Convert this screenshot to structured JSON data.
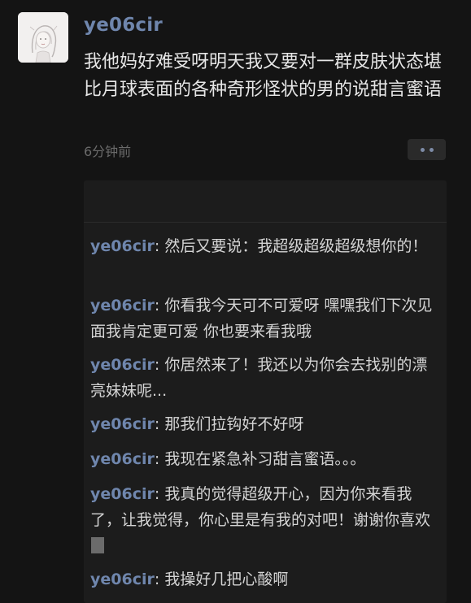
{
  "post": {
    "username": "ye06cir",
    "content": "我他妈好难受呀明天我又要对一群皮肤状态堪比月球表面的各种奇形怪状的男的说甜言蜜语",
    "timestamp": "6分钟前"
  },
  "comments": [
    {
      "author": "ye06cir",
      "sep": ": ",
      "text": "然后又要说：我超级超级超级想你的！"
    },
    {
      "author": "ye06cir",
      "sep": ": ",
      "text": "你看我今天可不可爱呀 嘿嘿我们下次见面我肯定更可爱 你也要来看我哦"
    },
    {
      "author": "ye06cir",
      "sep": ": ",
      "text": "你居然来了！我还以为你会去找别的漂亮妹妹呢..."
    },
    {
      "author": "ye06cir",
      "sep": ": ",
      "text": "那我们拉钩好不好呀"
    },
    {
      "author": "ye06cir",
      "sep": ": ",
      "text": "我现在紧急补习甜言蜜语。。。"
    },
    {
      "author": "ye06cir",
      "sep": ": ",
      "text": "我真的觉得超级开心，因为你来看我了，让我觉得，你心里是有我的对吧！谢谢你喜欢"
    },
    {
      "author": "ye06cir",
      "sep": ": ",
      "text": "我操好几把心酸啊"
    }
  ],
  "colors": {
    "background": "#141414",
    "panel": "#1c1c1c",
    "name_accent": "#6f86ad",
    "body_text": "#e6e6e6",
    "muted_text": "#6a6a6a"
  },
  "icons": {
    "more": "more-dots-icon",
    "avatar": "avatar-illustration"
  }
}
